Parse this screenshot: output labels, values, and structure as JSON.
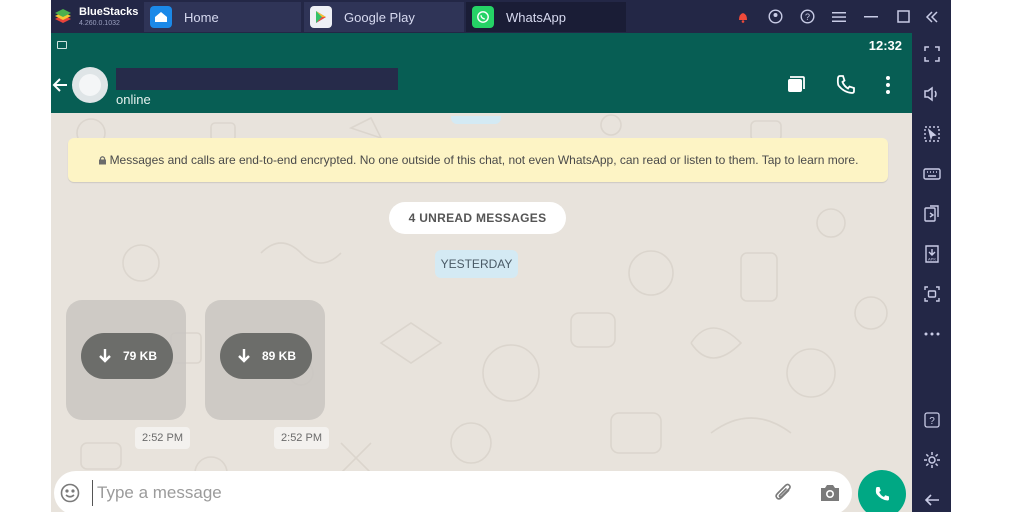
{
  "emulator": {
    "brand_name": "BlueStacks",
    "version": "4.260.0.1032",
    "tabs": [
      {
        "label": "Home",
        "icon": "home-icon"
      },
      {
        "label": "Google Play",
        "icon": "google-play-icon"
      },
      {
        "label": "WhatsApp",
        "icon": "whatsapp-icon"
      }
    ],
    "active_tab": "WhatsApp",
    "window_controls": [
      "notification-bell-icon",
      "account-icon",
      "help-icon",
      "menu-icon",
      "minimize-icon",
      "maximize-icon",
      "close-icon"
    ],
    "sidebar_icons": [
      "fullscreen-icon",
      "volume-icon",
      "pointer-icon",
      "keyboard-icon",
      "install-apk-icon",
      "apk-icon",
      "screenshot-icon",
      "more-icon",
      "help-icon",
      "settings-icon",
      "back-icon"
    ]
  },
  "android": {
    "status_time": "12:32"
  },
  "chat_header": {
    "contact_status": "online",
    "icons": [
      "back-arrow-icon",
      "video-call-icon",
      "call-icon",
      "overflow-menu-icon"
    ]
  },
  "chat": {
    "encryption_notice": "Messages and calls are end-to-end encrypted. No one outside of this chat, not even WhatsApp, can read or listen to them. Tap to learn more.",
    "unread_banner": "4 UNREAD MESSAGES",
    "date_divider": "YESTERDAY",
    "messages": [
      {
        "type": "media",
        "download_size": "79 KB",
        "time": "2:52 PM"
      },
      {
        "type": "media",
        "download_size": "89 KB",
        "time": "2:52 PM"
      }
    ]
  },
  "composer": {
    "placeholder": "Type a message",
    "value": ""
  },
  "colors": {
    "whatsapp_header": "#075e54",
    "send_button": "#00a884",
    "bluestacks_chrome": "#232746",
    "encryption_banner": "#fdf4c5"
  }
}
